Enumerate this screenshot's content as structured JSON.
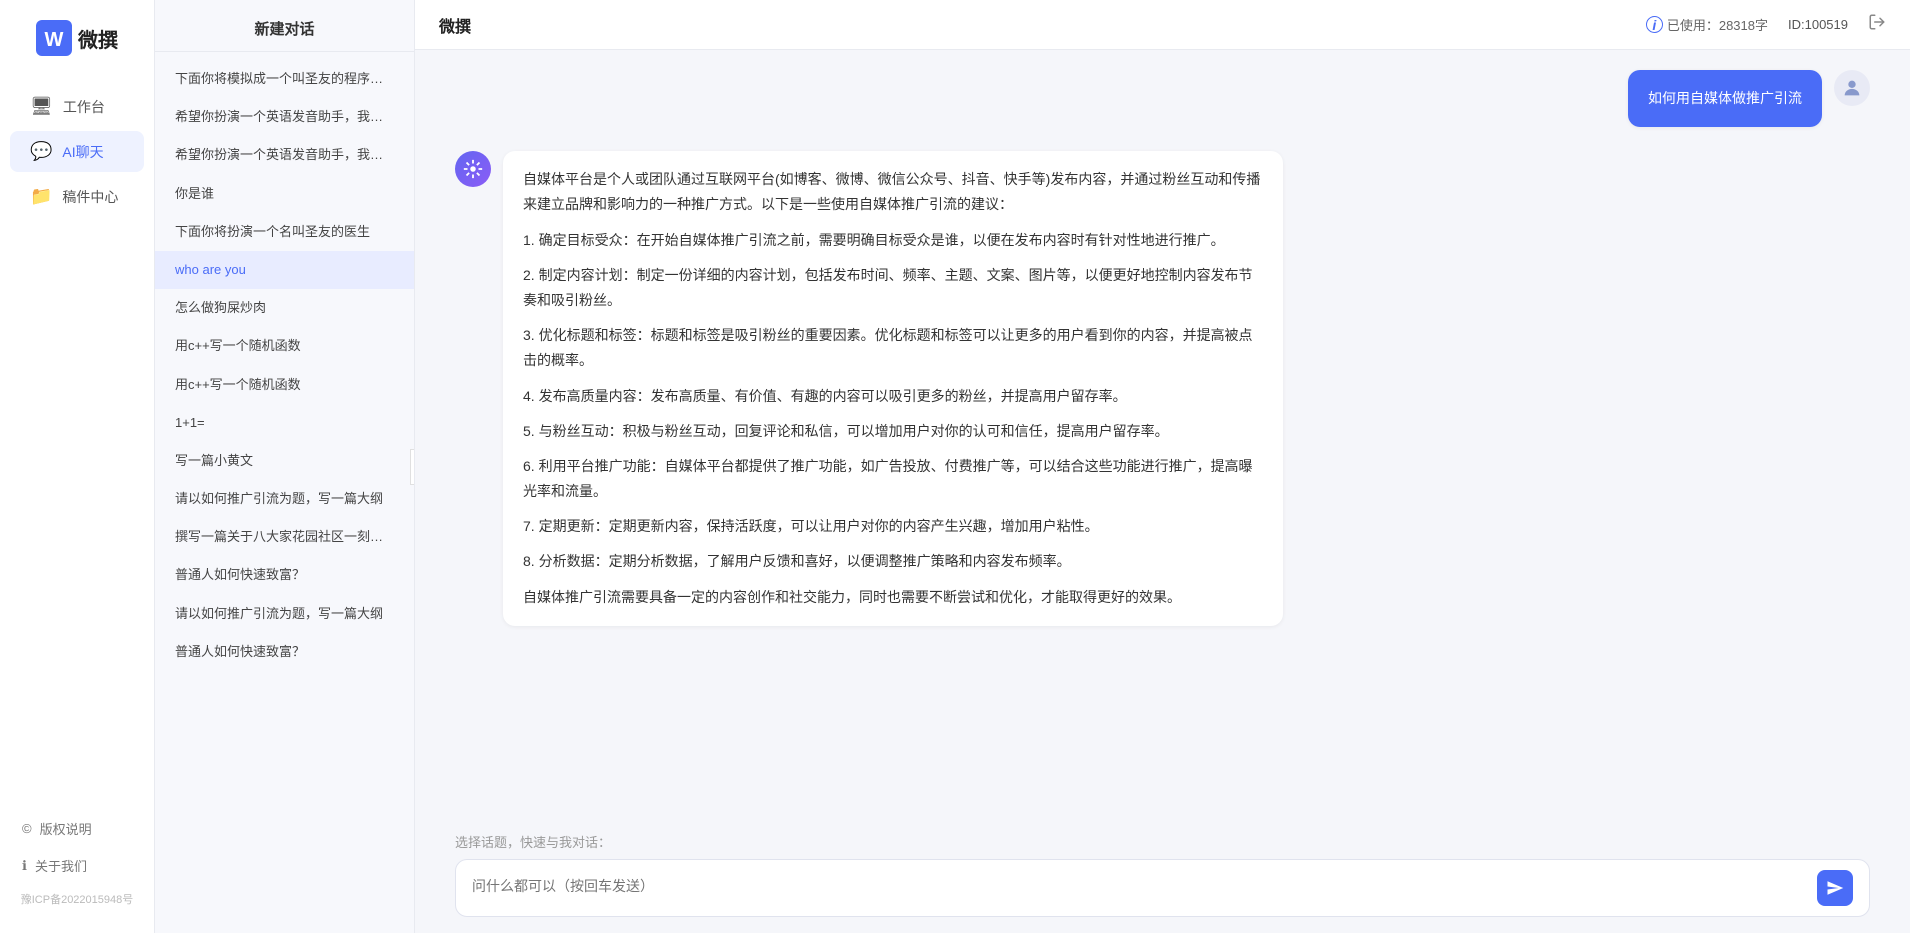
{
  "app": {
    "title": "微撰",
    "logo_letter": "W"
  },
  "topbar": {
    "title": "微撰",
    "usage_icon": "i-icon",
    "usage_label": "已使用：28318字",
    "id_label": "ID:100519",
    "logout_icon": "power-icon"
  },
  "nav": {
    "items": [
      {
        "id": "workbench",
        "label": "工作台",
        "icon": "🖥"
      },
      {
        "id": "aichat",
        "label": "AI聊天",
        "icon": "💬"
      },
      {
        "id": "mailcenter",
        "label": "稿件中心",
        "icon": "📁"
      }
    ],
    "bottom": [
      {
        "id": "copyright",
        "label": "版权说明",
        "icon": "©"
      },
      {
        "id": "about",
        "label": "关于我们",
        "icon": "ℹ"
      }
    ],
    "icp": "豫ICP备2022015948号"
  },
  "conv_panel": {
    "header": "新建对话",
    "items": [
      {
        "id": 1,
        "text": "下面你将模拟成一个叫圣友的程序员，我说..."
      },
      {
        "id": 2,
        "text": "希望你扮演一个英语发音助手，我提供给你..."
      },
      {
        "id": 3,
        "text": "希望你扮演一个英语发音助手，我提供给你..."
      },
      {
        "id": 4,
        "text": "你是谁"
      },
      {
        "id": 5,
        "text": "下面你将扮演一个名叫圣友的医生"
      },
      {
        "id": 6,
        "text": "who are you",
        "active": true
      },
      {
        "id": 7,
        "text": "怎么做狗屎炒肉"
      },
      {
        "id": 8,
        "text": "用c++写一个随机函数"
      },
      {
        "id": 9,
        "text": "用c++写一个随机函数"
      },
      {
        "id": 10,
        "text": "1+1="
      },
      {
        "id": 11,
        "text": "写一篇小黄文"
      },
      {
        "id": 12,
        "text": "请以如何推广引流为题，写一篇大纲"
      },
      {
        "id": 13,
        "text": "撰写一篇关于八大家花园社区一刻钟便民生..."
      },
      {
        "id": 14,
        "text": "普通人如何快速致富？"
      },
      {
        "id": 15,
        "text": "请以如何推广引流为题，写一篇大纲"
      },
      {
        "id": 16,
        "text": "普通人如何快速致富？"
      }
    ]
  },
  "chat": {
    "user_msg": "如何用自媒体做推广引流",
    "ai_response": {
      "para1": "自媒体平台是个人或团队通过互联网平台(如博客、微博、微信公众号、抖音、快手等)发布内容，并通过粉丝互动和传播来建立品牌和影响力的一种推广方式。以下是一些使用自媒体推广引流的建议：",
      "para2": "1. 确定目标受众：在开始自媒体推广引流之前，需要明确目标受众是谁，以便在发布内容时有针对性地进行推广。",
      "para3": "2. 制定内容计划：制定一份详细的内容计划，包括发布时间、频率、主题、文案、图片等，以便更好地控制内容发布节奏和吸引粉丝。",
      "para4": "3. 优化标题和标签：标题和标签是吸引粉丝的重要因素。优化标题和标签可以让更多的用户看到你的内容，并提高被点击的概率。",
      "para5": "4. 发布高质量内容：发布高质量、有价值、有趣的内容可以吸引更多的粉丝，并提高用户留存率。",
      "para6": "5. 与粉丝互动：积极与粉丝互动，回复评论和私信，可以增加用户对你的认可和信任，提高用户留存率。",
      "para7": "6. 利用平台推广功能：自媒体平台都提供了推广功能，如广告投放、付费推广等，可以结合这些功能进行推广，提高曝光率和流量。",
      "para8": "7. 定期更新：定期更新内容，保持活跃度，可以让用户对你的内容产生兴趣，增加用户粘性。",
      "para9": "8. 分析数据：定期分析数据，了解用户反馈和喜好，以便调整推广策略和内容发布频率。",
      "para10": "自媒体推广引流需要具备一定的内容创作和社交能力，同时也需要不断尝试和优化，才能取得更好的效果。"
    }
  },
  "input": {
    "placeholder": "问什么都可以（按回车发送）",
    "quick_topics_label": "选择话题，快速与我对话："
  }
}
